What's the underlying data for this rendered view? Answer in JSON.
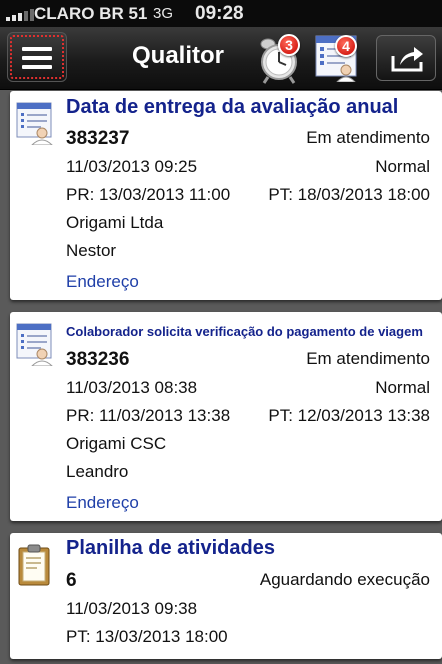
{
  "status_bar": {
    "carrier": "CLARO BR 51",
    "network": "3G",
    "time": "09:28"
  },
  "nav": {
    "title": "Qualitor",
    "alarm_badge": "3",
    "tasks_badge": "4",
    "menu_icon": "hamburger-menu-icon",
    "alarm_icon": "alarm-clock-icon",
    "tasks_icon": "task-list-user-icon",
    "share_icon": "share-export-icon"
  },
  "tickets": [
    {
      "icon": "ticket-user-icon",
      "title": "Data de entrega da avaliação anual",
      "number": "383237",
      "status": "Em atendimento",
      "opened": "11/03/2013 09:25",
      "priority": "Normal",
      "pr": "PR: 13/03/2013 11:00",
      "pt": "PT: 18/03/2013 18:00",
      "company": "Origami Ltda",
      "contact": "Nestor",
      "address_link": "Endereço"
    },
    {
      "icon": "ticket-user-icon",
      "title": "Colaborador solicita verificação do pagamento de viagem",
      "number": "383236",
      "status": "Em atendimento",
      "opened": "11/03/2013 08:38",
      "priority": "Normal",
      "pr": "PR: 11/03/2013 13:38",
      "pt": "PT: 12/03/2013 13:38",
      "company": "Origami CSC",
      "contact": "Leandro",
      "address_link": "Endereço"
    },
    {
      "icon": "clipboard-activity-icon",
      "title": "Planilha de atividades",
      "number": "6",
      "status": "Aguardando execução",
      "opened": "11/03/2013 09:38",
      "pt": "PT: 13/03/2013 18:00"
    }
  ],
  "colors": {
    "title_blue": "#14238c",
    "link_blue": "#1f3fa8",
    "badge_red": "#d8221a",
    "menu_highlight": "#e0302f",
    "background": "#5a5a5a"
  }
}
